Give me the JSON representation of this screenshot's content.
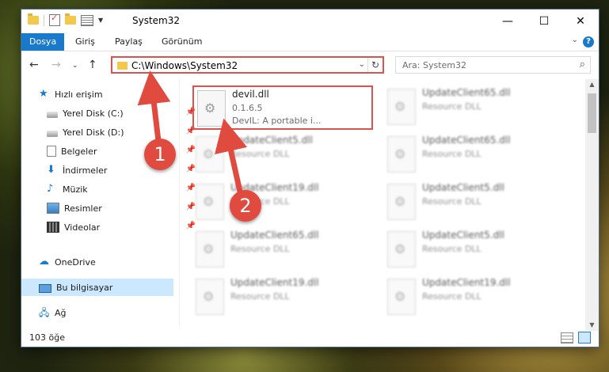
{
  "window": {
    "title": "System32"
  },
  "ribbon": {
    "tabs": [
      "Dosya",
      "Giriş",
      "Paylaş",
      "Görünüm"
    ]
  },
  "address": {
    "path": "C:\\Windows\\System32",
    "search_placeholder": "Ara: System32"
  },
  "nav": {
    "items": [
      {
        "label": "Hızlı erişim",
        "icon": "star-icon"
      },
      {
        "label": "Yerel Disk (C:)",
        "icon": "drive-icon",
        "pinned": true
      },
      {
        "label": "Yerel Disk (D:)",
        "icon": "drive-icon",
        "pinned": true
      },
      {
        "label": "Belgeler",
        "icon": "documents-icon",
        "pinned": true
      },
      {
        "label": "İndirmeler",
        "icon": "downloads-icon",
        "pinned": true
      },
      {
        "label": "Müzik",
        "icon": "music-icon",
        "pinned": true
      },
      {
        "label": "Resimler",
        "icon": "pictures-icon",
        "pinned": true
      },
      {
        "label": "Videolar",
        "icon": "videos-icon",
        "pinned": true
      },
      {
        "label": "OneDrive",
        "icon": "cloud-icon"
      },
      {
        "label": "Bu bilgisayar",
        "icon": "computer-icon",
        "selected": true
      },
      {
        "label": "Ağ",
        "icon": "network-icon"
      }
    ]
  },
  "files": [
    {
      "name": "devil.dll",
      "sub": "0.1.6.5",
      "desc": "DevIL: A portable i...",
      "highlighted": true
    },
    {
      "name": "UpdateClient65.dll",
      "sub": "Resource DLL"
    },
    {
      "name": "UpdateClient5.dll",
      "sub": "Resource DLL"
    },
    {
      "name": "UpdateClient65.dll",
      "sub": "Resource DLL"
    },
    {
      "name": "UpdateClient19.dll",
      "sub": "Resource DLL"
    },
    {
      "name": "UpdateClient5.dll",
      "sub": "Resource DLL"
    },
    {
      "name": "UpdateClient65.dll",
      "sub": "Resource DLL"
    },
    {
      "name": "UpdateClient5.dll",
      "sub": "Resource DLL"
    },
    {
      "name": "UpdateClient19.dll",
      "sub": "Resource DLL"
    },
    {
      "name": "UpdateClient19.dll",
      "sub": "Resource DLL"
    }
  ],
  "status": {
    "count": "103 öğe"
  },
  "annotations": {
    "marker1": "1",
    "marker2": "2"
  },
  "colors": {
    "accent": "#1979ca",
    "highlight": "#d9534f",
    "marker": "#e04a3f"
  }
}
